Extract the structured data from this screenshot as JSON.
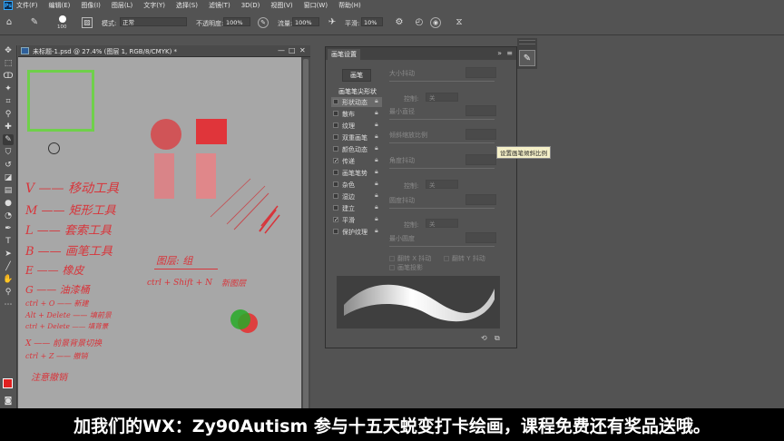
{
  "menubar": {
    "app_icon": "Ps",
    "items": [
      "文件(F)",
      "编辑(E)",
      "图像(I)",
      "图层(L)",
      "文字(Y)",
      "选择(S)",
      "滤镜(T)",
      "3D(D)",
      "视图(V)",
      "窗口(W)",
      "帮助(H)"
    ]
  },
  "options": {
    "brush_size": "100",
    "mode_label": "模式:",
    "mode_value": "正常",
    "opacity_label": "不透明度:",
    "opacity_value": "100%",
    "flow_label": "流量:",
    "flow_value": "100%",
    "smoothing_label": "平滑:",
    "smoothing_value": "10%"
  },
  "document": {
    "tab_title": "未标题-1.psd @ 27.4% (图层 1, RGB/8/CMYK) *",
    "controls": [
      "—",
      "□",
      "✕"
    ]
  },
  "canvas_notes": {
    "v": "V —— 移动工具",
    "m": "M —— 矩形工具",
    "l": "L —— 套索工具",
    "b": "B —— 画笔工具",
    "e": "E —— 橡皮",
    "g": "G —— 油漆桶",
    "ctrl_o": "ctrl + O —— 新建",
    "alt_delete": "Alt + Delete —— 填前景",
    "ctrl_delete": "ctrl + Delete —— 填背景",
    "x": "X —— 前景背景切换",
    "ctrl_z": "ctrl + Z —— 撤销",
    "note": "注意撤销",
    "layer": "图层: 组",
    "ctrl_shift_n": "ctrl + Shift + N",
    "new_layer": "新图层"
  },
  "brush_panel": {
    "tab": "画笔设置",
    "brushes_button": "画笔",
    "tip_shape": "画笔笔尖形状",
    "options": [
      {
        "label": "形状动态",
        "checked": false,
        "selected": true
      },
      {
        "label": "散布",
        "checked": false,
        "selected": false
      },
      {
        "label": "纹理",
        "checked": false,
        "selected": false
      },
      {
        "label": "双重画笔",
        "checked": false,
        "selected": false
      },
      {
        "label": "颜色动态",
        "checked": false,
        "selected": false
      },
      {
        "label": "传递",
        "checked": true,
        "selected": false
      },
      {
        "label": "画笔笔势",
        "checked": false,
        "selected": false
      },
      {
        "label": "杂色",
        "checked": false,
        "selected": false
      },
      {
        "label": "湿边",
        "checked": false,
        "selected": false
      },
      {
        "label": "建立",
        "checked": false,
        "selected": false
      },
      {
        "label": "平滑",
        "checked": true,
        "selected": false
      },
      {
        "label": "保护纹理",
        "checked": false,
        "selected": false
      }
    ],
    "params": {
      "size_jitter": "大小抖动",
      "control1": "控制:",
      "control1_value": "关",
      "min_diameter": "最小直径",
      "tilt_scale": "倾斜缩放比例",
      "angle_jitter": "角度抖动",
      "control2": "控制:",
      "control2_value": "关",
      "roundness_jitter": "圆度抖动",
      "control3": "控制:",
      "control3_value": "关",
      "min_roundness": "最小圆度",
      "flip_x": "翻转 X 抖动",
      "flip_y": "翻转 Y 抖动",
      "brush_projection": "画笔投影"
    }
  },
  "tooltip": "设置画笔倾斜比例",
  "subtitle": "加我们的WX：Zy90Autism  参与十五天蜕变打卡绘画，课程免费还有奖品送哦。",
  "colors": {
    "ui_bg": "#535353",
    "canvas": "#a7a7a7",
    "ink_red": "#d8343a",
    "green_rect": "#6fd04a",
    "fg_color": "#e02020",
    "bg_color": "#2aa02a"
  }
}
